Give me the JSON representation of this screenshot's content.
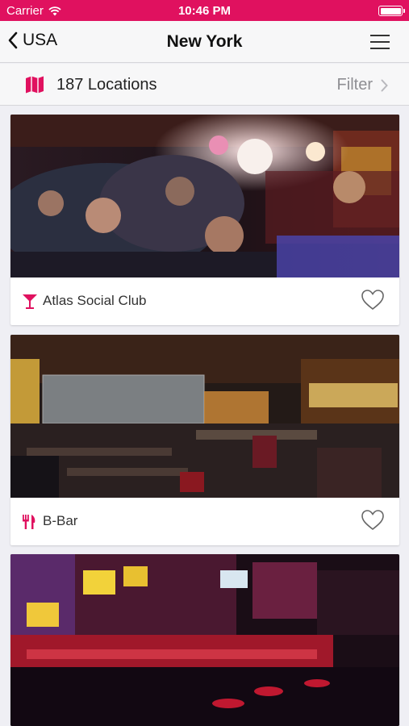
{
  "status_bar": {
    "carrier": "Carrier",
    "time": "10:46 PM",
    "battery_level": 1.0
  },
  "nav": {
    "back_label": "USA",
    "title": "New York"
  },
  "sub_bar": {
    "locations_label": "187 Locations",
    "filter_label": "Filter"
  },
  "cards": [
    {
      "name": "Atlas Social Club",
      "category_icon": "cocktail-icon",
      "favorite_icon": "heart-outline-icon"
    },
    {
      "name": "B-Bar",
      "category_icon": "restaurant-icon",
      "favorite_icon": "heart-outline-icon"
    },
    {
      "name": "",
      "category_icon": "",
      "favorite_icon": ""
    }
  ],
  "colors": {
    "accent": "#e0115f",
    "background": "#efeff4",
    "bar": "#f7f7f8"
  }
}
